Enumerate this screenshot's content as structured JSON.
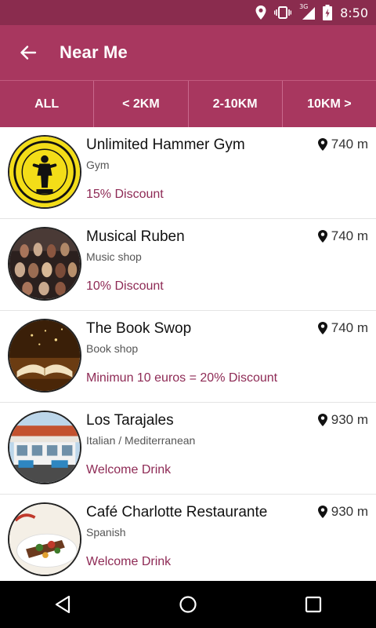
{
  "status_bar": {
    "time": "8:50",
    "network": "3G"
  },
  "app_bar": {
    "title": "Near Me"
  },
  "tabs": [
    {
      "label": "ALL"
    },
    {
      "label": "< 2KM"
    },
    {
      "label": "2-10KM"
    },
    {
      "label": "10KM >"
    }
  ],
  "places": [
    {
      "name": "Unlimited Hammer Gym",
      "category": "Gym",
      "offer": "15% Discount",
      "distance": "740 m"
    },
    {
      "name": "Musical Ruben",
      "category": "Music shop",
      "offer": "10% Discount",
      "distance": "740 m"
    },
    {
      "name": "The Book Swop",
      "category": "Book shop",
      "offer": "Minimun 10 euros = 20% Discount",
      "distance": "740 m"
    },
    {
      "name": "Los Tarajales",
      "category": "Italian / Mediterranean",
      "offer": "Welcome Drink",
      "distance": "930 m"
    },
    {
      "name": "Café Charlotte Restaurante",
      "category": "Spanish",
      "offer": "Welcome Drink",
      "distance": "930 m"
    }
  ],
  "colors": {
    "primary": "#a8375f",
    "primary_dark": "#8a2c4e",
    "offer_text": "#8e2a55"
  }
}
